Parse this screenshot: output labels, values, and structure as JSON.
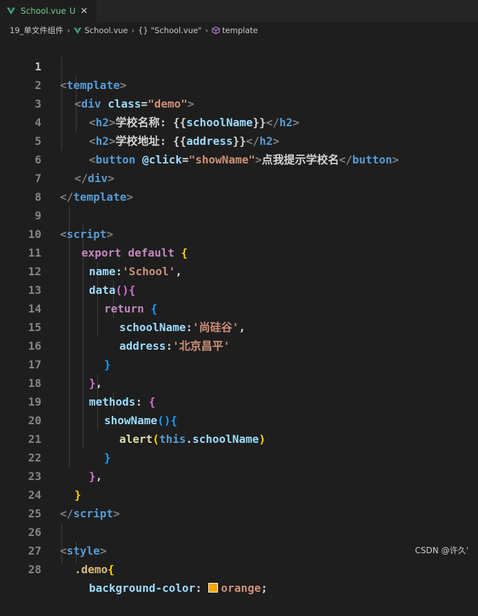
{
  "tab": {
    "file_name": "School.vue",
    "status_badge": "U",
    "close_glyph": "✕",
    "status_color": "#73c991"
  },
  "breadcrumb": {
    "folder": "19_单文件组件",
    "file": "School.vue",
    "object_braces": "{}",
    "object": "\"School.vue\"",
    "element": "template"
  },
  "editor": {
    "active_line": 1,
    "line_numbers": [
      "1",
      "2",
      "3",
      "4",
      "5",
      "6",
      "7",
      "8",
      "9",
      "10",
      "11",
      "12",
      "13",
      "14",
      "15",
      "16",
      "17",
      "18",
      "19",
      "20",
      "21",
      "22",
      "23",
      "24",
      "25",
      "26",
      "27",
      "28"
    ],
    "lines": {
      "l1": {
        "a": "<",
        "b": "template",
        "c": ">"
      },
      "l2": {
        "a": "<",
        "b": "div",
        "c": "class",
        "d": "=",
        "e": "\"demo\"",
        "f": ">"
      },
      "l3": {
        "a": "<",
        "b": "h2",
        "c": ">",
        "d": "学校名称: ",
        "e": "{{",
        "f": "schoolName",
        "g": "}}",
        "h": "</",
        "i": "h2",
        "j": ">"
      },
      "l4": {
        "a": "<",
        "b": "h2",
        "c": ">",
        "d": "学校地址: ",
        "e": "{{",
        "f": "address",
        "g": "}}",
        "h": "</",
        "i": "h2",
        "j": ">"
      },
      "l5": {
        "a": "<",
        "b": "button",
        "c": "@click",
        "d": "=",
        "e": "\"showName\"",
        "f": ">",
        "g": "点我提示学校名",
        "h": "</",
        "i": "button",
        "j": ">"
      },
      "l6": {
        "a": "</",
        "b": "div",
        "c": ">"
      },
      "l7": {
        "a": "</",
        "b": "template",
        "c": ">"
      },
      "l9": {
        "a": "<",
        "b": "script",
        "c": ">"
      },
      "l10": {
        "a": "export",
        "b": "default",
        "c": "{"
      },
      "l11": {
        "a": "name",
        "b": ":",
        "c": "'School'",
        "d": ","
      },
      "l12": {
        "a": "data",
        "b": "()",
        "c": "{"
      },
      "l13": {
        "a": "return",
        "b": "{"
      },
      "l14": {
        "a": "schoolName",
        "b": ":",
        "c": "'尚硅谷'",
        "d": ","
      },
      "l15": {
        "a": "address",
        "b": ":",
        "c": "'北京昌平'"
      },
      "l16": {
        "a": "}"
      },
      "l17": {
        "a": "}",
        "b": ","
      },
      "l18": {
        "a": "methods",
        "b": ":",
        "c": "{"
      },
      "l19": {
        "a": "showName",
        "b": "()",
        "c": "{"
      },
      "l20": {
        "a": "alert",
        "b": "(",
        "c": "this",
        "d": ".",
        "e": "schoolName",
        "f": ")"
      },
      "l21": {
        "a": "}"
      },
      "l22": {
        "a": "}",
        "b": ","
      },
      "l23": {
        "a": "}"
      },
      "l24": {
        "a": "</",
        "b": "script",
        "c": ">"
      },
      "l26": {
        "a": "<",
        "b": "style",
        "c": ">"
      },
      "l27": {
        "a": ".demo",
        "b": "{"
      },
      "l28": {
        "a": "background-color",
        "b": ":",
        "c": "orange",
        "d": ";"
      }
    },
    "swatch_color": "#ffa500"
  },
  "watermark": "CSDN @许久'"
}
